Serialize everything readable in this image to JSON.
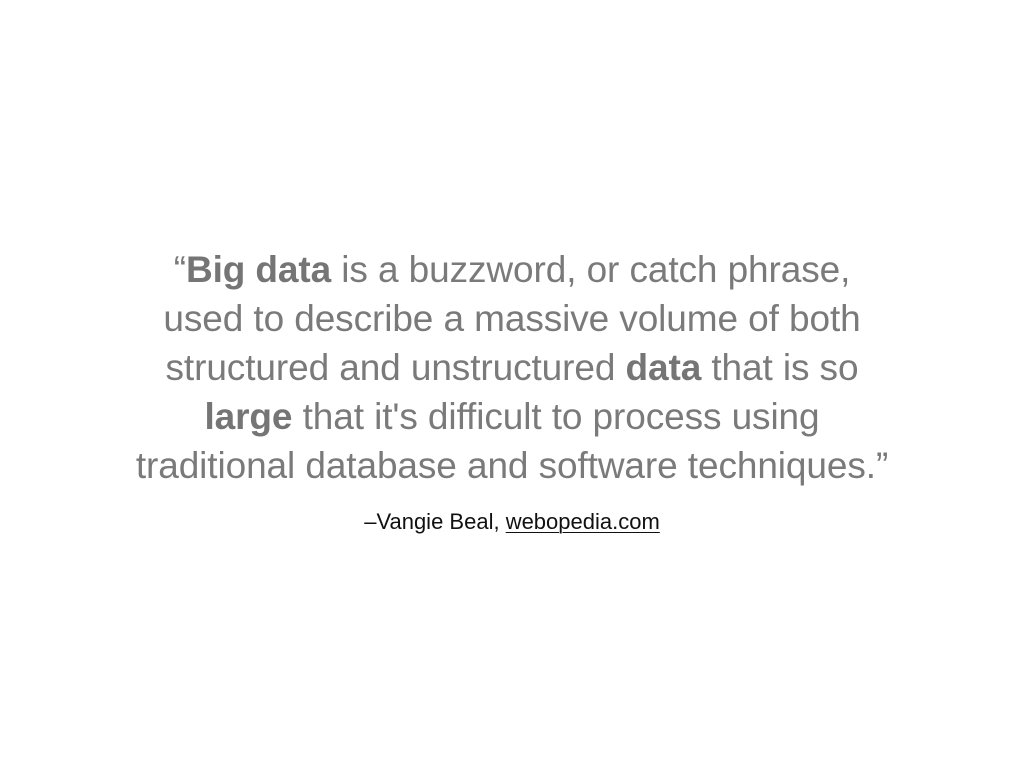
{
  "quote": {
    "line1": {
      "open_mark": "“",
      "bold": "Big data",
      "rest": " is a buzzword, or catch phrase,"
    },
    "line2": {
      "text": "used to describe a massive volume of both"
    },
    "line3": {
      "before": "structured and unstructured ",
      "bold": "data",
      "after": " that is so"
    },
    "line4": {
      "bold": "large",
      "rest": " that it's difficult to process using"
    },
    "line5": {
      "text": "traditional database and software techniques.",
      "close_mark": "”"
    }
  },
  "attribution": {
    "author": "–Vangie Beal, ",
    "source_link": "webopedia.com"
  },
  "colors": {
    "background": "#ffffff",
    "quote_text": "#7a7a7a",
    "attribution_text": "#111111"
  }
}
